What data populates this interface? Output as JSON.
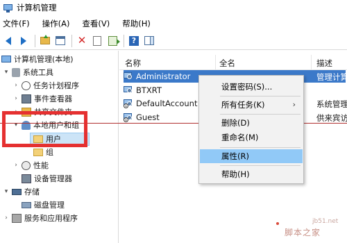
{
  "window": {
    "title": "计算机管理"
  },
  "menubar": [
    {
      "label": "文件(F)"
    },
    {
      "label": "操作(A)"
    },
    {
      "label": "查看(V)"
    },
    {
      "label": "帮助(H)"
    }
  ],
  "toolbar": {
    "icons": [
      "back-arrow-icon",
      "forward-arrow-icon",
      "up-folder-icon",
      "show-hide-tree-icon",
      "delete-icon",
      "properties-icon",
      "export-list-icon",
      "help-icon",
      "action-pane-icon"
    ]
  },
  "tree": {
    "root": "计算机管理(本地)",
    "system_tools": "系统工具",
    "task_scheduler": "任务计划程序",
    "event_viewer": "事件查看器",
    "shared_folders": "共享文件夹",
    "local_users_groups": "本地用户和组",
    "users": "用户",
    "groups": "组",
    "performance": "性能",
    "device_manager": "设备管理器",
    "storage": "存储",
    "disk_management": "磁盘管理",
    "services_apps": "服务和应用程序"
  },
  "list": {
    "columns": [
      "名称",
      "全名",
      "描述"
    ],
    "rows": [
      {
        "name": "Administrator",
        "desc": "管理计算",
        "selected": true
      },
      {
        "name": "BTXRT",
        "desc": ""
      },
      {
        "name": "DefaultAccount",
        "desc": "系统管理"
      },
      {
        "name": "Guest",
        "desc": "供来宾访"
      }
    ]
  },
  "context_menu": {
    "set_password": "设置密码(S)...",
    "all_tasks": "所有任务(K)",
    "submenu_arrow": "›",
    "delete": "删除(D)",
    "rename": "重命名(M)",
    "properties": "属性(R)",
    "help": "帮助(H)"
  },
  "watermark": {
    "url": "jb51.net",
    "text": "脚本之家"
  },
  "colors": {
    "highlight": "#3b79c9",
    "menu_hover": "#91c9f7",
    "annotation_red": "#e53030"
  }
}
